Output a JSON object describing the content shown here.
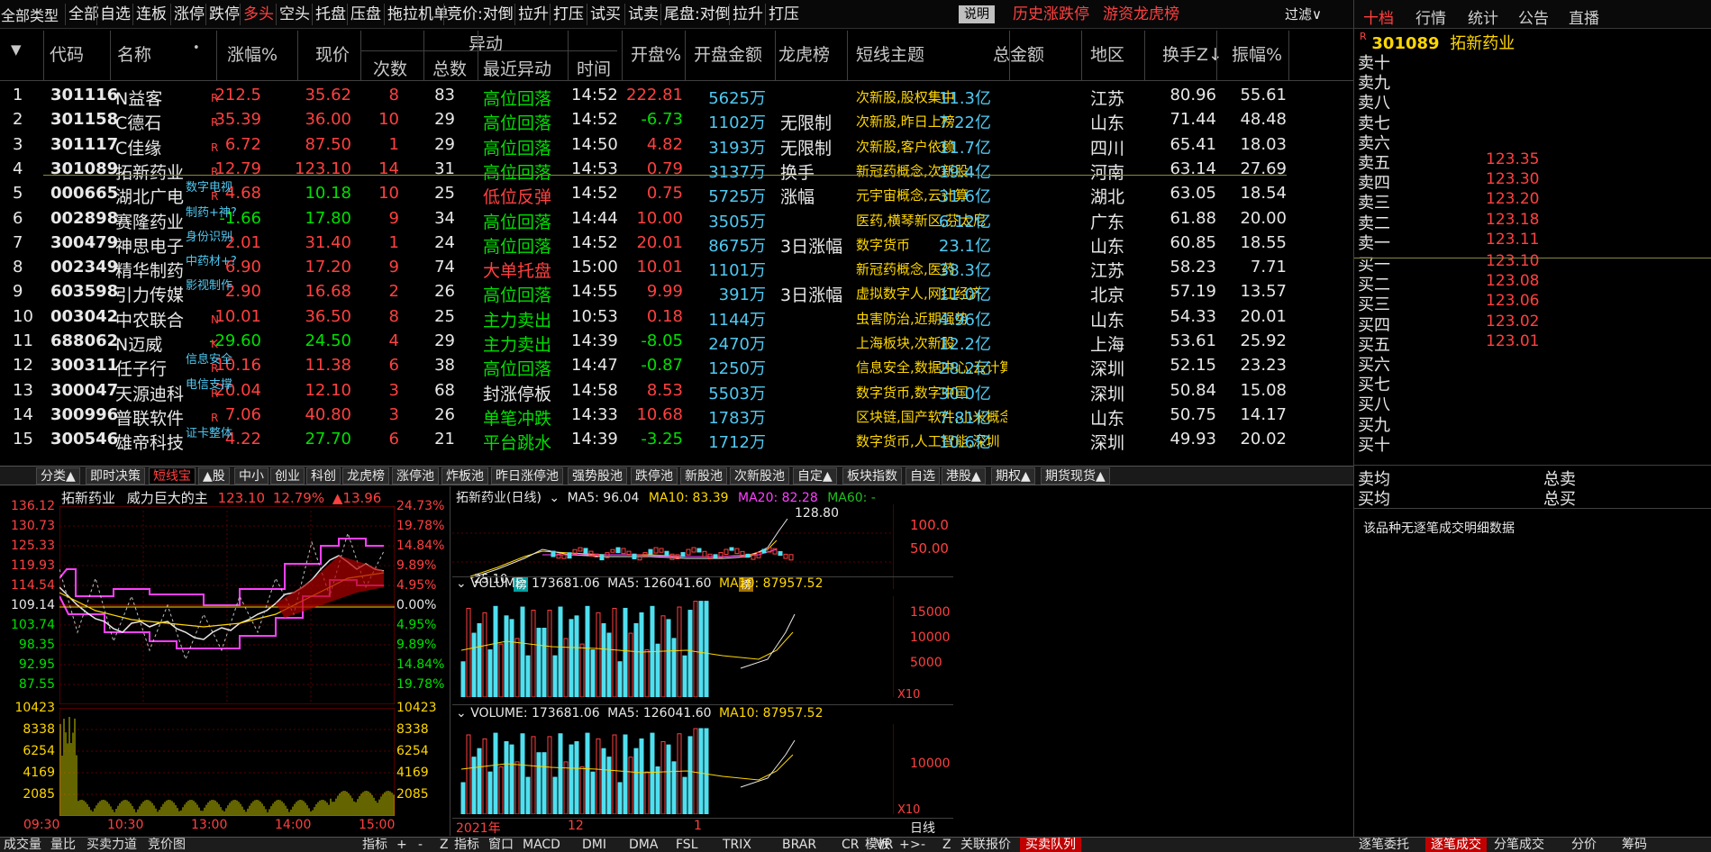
{
  "menu": {
    "title": "全部类型",
    "items": [
      "全部",
      "自选",
      "连板",
      "涨停",
      "跌停",
      "多头",
      "空头",
      "托盘",
      "压盘",
      "拖拉机单",
      "竞价:对倒",
      "拉升",
      "打压",
      "试买",
      "试卖",
      "尾盘:对倒",
      "拉升",
      "打压"
    ],
    "help": "说明",
    "links": [
      "历史涨跌停",
      "游资龙虎榜"
    ],
    "filter": "过滤∨"
  },
  "right_tabs": [
    "十档",
    "行情",
    "统计",
    "公告",
    "直播"
  ],
  "table": {
    "headers": {
      "sort": "▼",
      "code": "代码",
      "name": "名称",
      "dot": "•",
      "change": "涨幅%",
      "price": "现价",
      "anomaly": "异动",
      "times": "次数",
      "total": "总数",
      "recent": "最近异动",
      "time": "时间",
      "open_pct": "开盘%",
      "open_amt": "开盘金额",
      "lhb": "龙虎榜",
      "theme": "短线主题",
      "total_amt": "总金额",
      "region": "地区",
      "turnover": "换手Z↓",
      "amplitude": "振幅%"
    },
    "rows": [
      {
        "n": "1",
        "code": "301116",
        "name": "N益客",
        "tag": "R",
        "ctag": "",
        "chg": "212.5",
        "price": "35.62",
        "times": "8",
        "total": "83",
        "recent": "高位回落",
        "time": "14:52",
        "open": "222.81",
        "amt": "5625万",
        "lhb": "",
        "theme": "次新股,股权集中",
        "tamt": "11.3亿",
        "region": "江苏",
        "turn": "80.96",
        "amp": "55.61",
        "up": true,
        "recentColor": "g"
      },
      {
        "n": "2",
        "code": "301158",
        "name": "C德石",
        "tag": "R",
        "ctag": "",
        "chg": "35.39",
        "price": "36.00",
        "times": "10",
        "total": "29",
        "recent": "高位回落",
        "time": "14:52",
        "open": "-6.73",
        "amt": "1102万",
        "lhb": "无限制",
        "theme": "次新股,昨日上榜",
        "tamt": "7.22亿",
        "region": "山东",
        "turn": "71.44",
        "amp": "48.48",
        "up": true,
        "recentColor": "g"
      },
      {
        "n": "3",
        "code": "301117",
        "name": "C佳缘",
        "tag": "R",
        "ctag": "",
        "chg": "6.72",
        "price": "87.50",
        "times": "1",
        "total": "29",
        "recent": "高位回落",
        "time": "14:50",
        "open": "4.82",
        "amt": "3193万",
        "lhb": "无限制",
        "theme": "次新股,客户依赖",
        "tamt": "11.7亿",
        "region": "四川",
        "turn": "65.41",
        "amp": "18.03",
        "up": true,
        "recentColor": "g"
      },
      {
        "n": "4",
        "code": "301089",
        "name": "拓新药业",
        "tag": "R",
        "ctag": "",
        "chg": "12.79",
        "price": "123.10",
        "times": "14",
        "total": "31",
        "recent": "高位回落",
        "time": "14:53",
        "open": "0.79",
        "amt": "3137万",
        "lhb": "换手",
        "theme": "新冠药概念,次新股",
        "tamt": "19.4亿",
        "region": "河南",
        "turn": "63.14",
        "amp": "27.69",
        "up": true,
        "recentColor": "g"
      },
      {
        "n": "5",
        "code": "000665",
        "name": "湖北广电",
        "tag": "R",
        "ctag": "数字电视",
        "chg": "4.68",
        "price": "10.18",
        "times": "10",
        "total": "25",
        "recent": "低位反弹",
        "time": "14:52",
        "open": "0.75",
        "amt": "5725万",
        "lhb": "涨幅",
        "theme": "元宇宙概念,云计算",
        "tamt": "31.6亿",
        "region": "湖北",
        "turn": "63.05",
        "amp": "18.54",
        "up": false,
        "recentColor": "r"
      },
      {
        "n": "6",
        "code": "002898",
        "name": "赛隆药业",
        "tag": "",
        "ctag": "制药+神?",
        "chg": "-1.66",
        "price": "17.80",
        "times": "9",
        "total": "34",
        "recent": "高位回落",
        "time": "14:44",
        "open": "10.00",
        "amt": "3505万",
        "lhb": "",
        "theme": "医药,横琴新区,芬太尼",
        "tamt": "6.12亿",
        "region": "广东",
        "turn": "61.88",
        "amp": "20.00",
        "up": false,
        "recentColor": "g"
      },
      {
        "n": "7",
        "code": "300479",
        "name": "神思电子",
        "tag": "",
        "ctag": "身份识别",
        "chg": "2.01",
        "price": "31.40",
        "times": "1",
        "total": "24",
        "recent": "高位回落",
        "time": "14:52",
        "open": "20.01",
        "amt": "8675万",
        "lhb": "3日涨幅",
        "theme": "数字货币",
        "tamt": "23.1亿",
        "region": "山东",
        "turn": "60.85",
        "amp": "18.55",
        "up": true,
        "recentColor": "g"
      },
      {
        "n": "8",
        "code": "002349",
        "name": "精华制药",
        "tag": "",
        "ctag": "中药材+?",
        "chg": "6.90",
        "price": "17.20",
        "times": "9",
        "total": "74",
        "recent": "大单托盘",
        "time": "15:00",
        "open": "10.01",
        "amt": "1101万",
        "lhb": "",
        "theme": "新冠药概念,医药",
        "tamt": "38.3亿",
        "region": "江苏",
        "turn": "58.23",
        "amp": "7.71",
        "up": true,
        "recentColor": "r"
      },
      {
        "n": "9",
        "code": "603598",
        "name": "引力传媒",
        "tag": "",
        "ctag": "影视制作",
        "chg": "2.90",
        "price": "16.68",
        "times": "2",
        "total": "26",
        "recent": "高位回落",
        "time": "14:55",
        "open": "9.99",
        "amt": "391万",
        "lhb": "3日涨幅",
        "theme": "虚拟数字人,网红经济",
        "tamt": "11.0亿",
        "region": "北京",
        "turn": "57.19",
        "amp": "13.57",
        "up": true,
        "recentColor": "g"
      },
      {
        "n": "10",
        "code": "003042",
        "name": "中农联合",
        "tag": "N",
        "ctag": "",
        "chg": "10.01",
        "price": "36.50",
        "times": "8",
        "total": "25",
        "recent": "主力卖出",
        "time": "10:53",
        "open": "0.18",
        "amt": "1144万",
        "lhb": "",
        "theme": "虫害防治,近期强势",
        "tamt": "4.96亿",
        "region": "山东",
        "turn": "54.33",
        "amp": "20.01",
        "up": true,
        "recentColor": "g"
      },
      {
        "n": "11",
        "code": "688062",
        "name": "N迈威",
        "tag": "K",
        "ctag": "",
        "chg": "-29.60",
        "price": "24.50",
        "times": "4",
        "total": "29",
        "recent": "主力卖出",
        "time": "14:39",
        "open": "-8.05",
        "amt": "2470万",
        "lhb": "",
        "theme": "上海板块,次新股",
        "tamt": "12.2亿",
        "region": "上海",
        "turn": "53.61",
        "amp": "25.92",
        "up": false,
        "recentColor": "g"
      },
      {
        "n": "12",
        "code": "300311",
        "name": "任子行",
        "tag": "R",
        "ctag": "信息安全",
        "chg": "10.16",
        "price": "11.38",
        "times": "6",
        "total": "38",
        "recent": "高位回落",
        "time": "14:47",
        "open": "-0.87",
        "amt": "1250万",
        "lhb": "",
        "theme": "信息安全,数据中心,云计算",
        "tamt": "28.2亿",
        "region": "深圳",
        "turn": "52.15",
        "amp": "23.23",
        "up": true,
        "recentColor": "g"
      },
      {
        "n": "13",
        "code": "300047",
        "name": "天源迪科",
        "tag": "R",
        "ctag": "电信支撑",
        "chg": "20.04",
        "price": "12.10",
        "times": "3",
        "total": "68",
        "recent": "封涨停板",
        "time": "14:58",
        "open": "8.53",
        "amt": "5503万",
        "lhb": "",
        "theme": "数字货币,数字中国",
        "tamt": "30.0亿",
        "region": "深圳",
        "turn": "50.84",
        "amp": "15.08",
        "up": true,
        "recentColor": "w"
      },
      {
        "n": "14",
        "code": "300996",
        "name": "普联软件",
        "tag": "R",
        "ctag": "",
        "chg": "7.06",
        "price": "40.80",
        "times": "3",
        "total": "26",
        "recent": "单笔冲跌",
        "time": "14:33",
        "open": "10.68",
        "amt": "1783万",
        "lhb": "",
        "theme": "区块链,国产软件,小米概念",
        "tamt": "7.81亿",
        "region": "山东",
        "turn": "50.75",
        "amp": "14.17",
        "up": true,
        "recentColor": "g"
      },
      {
        "n": "15",
        "code": "300546",
        "name": "雄帝科技",
        "tag": "",
        "ctag": "证卡整体",
        "chg": "4.22",
        "price": "27.70",
        "times": "6",
        "total": "21",
        "recent": "平台跳水",
        "time": "14:39",
        "open": "-3.25",
        "amt": "1712万",
        "lhb": "",
        "theme": "数字货币,人工智能,深圳",
        "tamt": "10.6亿",
        "region": "深圳",
        "turn": "49.93",
        "amp": "20.02",
        "up": false,
        "recentColor": "g"
      }
    ]
  },
  "bottom_tabs": [
    "分类▲",
    "即时决策",
    "短线宝",
    "▲股",
    "中小",
    "创业",
    "科创",
    "龙虎榜",
    "涨停池",
    "炸板池",
    "昨日涨停池",
    "强势股池",
    "跌停池",
    "新股池",
    "次新股池",
    "自定▲",
    "板块指数",
    "自选",
    "港股▲",
    "期权▲",
    "期货现货▲"
  ],
  "intraday": {
    "name": "拓新药业",
    "desc": "威力巨大的主",
    "price": "123.10",
    "pct": "12.79%",
    "chg": "▲13.96",
    "left_axis": [
      "136.12",
      "130.73",
      "125.33",
      "119.93",
      "114.54",
      "109.14",
      "103.74",
      "98.35",
      "92.95",
      "87.55"
    ],
    "right_axis": [
      "24.73%",
      "19.78%",
      "14.84%",
      "9.89%",
      "4.95%",
      "0.00%",
      "4.95%",
      "9.89%",
      "14.84%",
      "19.78%"
    ],
    "vol_axis": [
      "10423",
      "8338",
      "6254",
      "4169",
      "2085"
    ],
    "times": [
      "09:30",
      "10:30",
      "13:00",
      "14:00",
      "15:00"
    ]
  },
  "daily": {
    "title": "拓新药业(日线)",
    "ma5": "MA5: 96.04",
    "ma10": "MA10: 83.39",
    "ma20": "MA20: 82.28",
    "ma60": "MA60: -",
    "high": "128.80",
    "low": "25.10",
    "axis": [
      "100.0",
      "50.00"
    ],
    "badge1": "榜",
    "badge2": "榜",
    "vol1": "VOLUME: 173681.06",
    "vol1_ma5": "MA5: 126041.60",
    "vol1_ma10": "MA10: 87957.52",
    "vol_axis": [
      "15000",
      "10000",
      "5000"
    ],
    "x10": "X10",
    "vol2": "VOLUME: 173681.06",
    "vol2_ma5": "MA5: 126041.60",
    "vol2_ma10": "MA10: 87957.52",
    "vol2_axis": "10000",
    "dates": [
      "2021年",
      "12",
      "1"
    ],
    "period": "日线"
  },
  "orderbook": {
    "code": "301089",
    "name": "拓新药业",
    "tag": "R",
    "sells": [
      {
        "label": "卖十",
        "price": ""
      },
      {
        "label": "卖九",
        "price": ""
      },
      {
        "label": "卖八",
        "price": ""
      },
      {
        "label": "卖七",
        "price": ""
      },
      {
        "label": "卖六",
        "price": ""
      },
      {
        "label": "卖五",
        "price": "123.35"
      },
      {
        "label": "卖四",
        "price": "123.30"
      },
      {
        "label": "卖三",
        "price": "123.20"
      },
      {
        "label": "卖二",
        "price": "123.18"
      },
      {
        "label": "卖一",
        "price": "123.11"
      }
    ],
    "buys": [
      {
        "label": "买一",
        "price": "123.10"
      },
      {
        "label": "买二",
        "price": "123.08"
      },
      {
        "label": "买三",
        "price": "123.06"
      },
      {
        "label": "买四",
        "price": "123.02"
      },
      {
        "label": "买五",
        "price": "123.01"
      },
      {
        "label": "买六",
        "price": ""
      },
      {
        "label": "买七",
        "price": ""
      },
      {
        "label": "买八",
        "price": ""
      },
      {
        "label": "买九",
        "price": ""
      },
      {
        "label": "买十",
        "price": ""
      }
    ],
    "avg_sell": "卖均",
    "total_sell": "总卖",
    "avg_buy": "买均",
    "total_buy": "总买",
    "no_data": "该品种无逐笔成交明细数据"
  },
  "footer": {
    "left": [
      "成交量",
      "量比",
      "买卖力道",
      "竞价图"
    ],
    "mid": [
      "指标",
      "+",
      "-",
      "Z",
      "指标",
      "窗口",
      "MACD",
      "DMI",
      "DMA",
      "FSL",
      "TRIX",
      "BRAR",
      "CR",
      "VR",
      ">",
      "模板",
      "+",
      "-",
      "Z",
      "关联报价",
      "买卖队列"
    ],
    "right": [
      "逐笔委托",
      "逐笔成交",
      "分笔成交",
      "分价",
      "筹码"
    ]
  }
}
